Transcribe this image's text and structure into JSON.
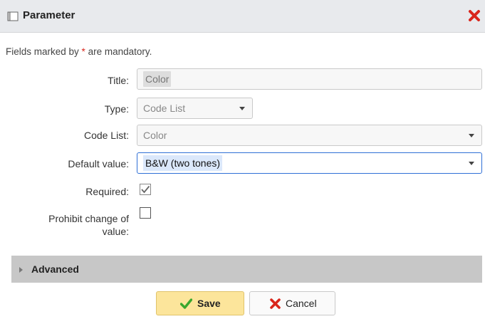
{
  "dialog": {
    "title": "Parameter",
    "mandatory_note_prefix": "Fields marked by ",
    "mandatory_note_star": "*",
    "mandatory_note_suffix": " are mandatory."
  },
  "form": {
    "title_label": "Title:",
    "title_value": "Color",
    "type_label": "Type:",
    "type_value": "Code List",
    "code_list_label": "Code List:",
    "code_list_value": "Color",
    "default_value_label": "Default value:",
    "default_value_value": "B&W (two tones)",
    "required_label": "Required:",
    "required_checked": true,
    "prohibit_label_line1": "Prohibit change of",
    "prohibit_label_line2": "value:",
    "prohibit_checked": false
  },
  "advanced": {
    "label": "Advanced"
  },
  "buttons": {
    "save_label": "Save",
    "cancel_label": "Cancel"
  },
  "colors": {
    "titlebar": "#e8eaed",
    "close": "#d9261c",
    "save_bg": "#fce59b",
    "save_check": "#3aa82e",
    "cancel_x": "#d9261c",
    "focus_border": "#2f6fd6",
    "advanced_bg": "#c7c7c7"
  },
  "icons": {
    "title": "window-icon",
    "close": "close-icon",
    "save": "checkmark-icon",
    "cancel": "x-icon",
    "dropdown": "chevron-down-icon",
    "advanced": "triangle-right-icon"
  }
}
